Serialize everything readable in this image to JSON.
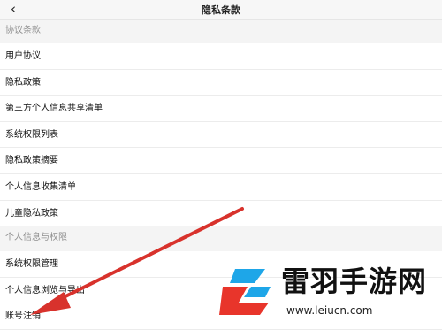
{
  "header": {
    "back_icon": "chevron-left-icon",
    "back_glyph": "‹",
    "title": "隐私条款"
  },
  "sections": [
    {
      "title": "协议条款",
      "items": [
        "用户协议",
        "隐私政策",
        "第三方个人信息共享清单",
        "系统权限列表",
        "隐私政策摘要",
        "个人信息收集清单",
        "儿童隐私政策"
      ]
    },
    {
      "title": "个人信息与权限",
      "items": [
        "系统权限管理",
        "个人信息浏览与导出",
        "账号注销"
      ]
    }
  ],
  "overlay": {
    "arrow_color": "#d8322c",
    "arrow_icon": "red-arrow-annotation"
  },
  "watermark": {
    "name": "雷羽手游网",
    "url": "www.leiucn.com",
    "logo_icon": "leiyu-logo-icon",
    "brand_red": "#e8352b",
    "brand_blue": "#1ea6e8"
  }
}
